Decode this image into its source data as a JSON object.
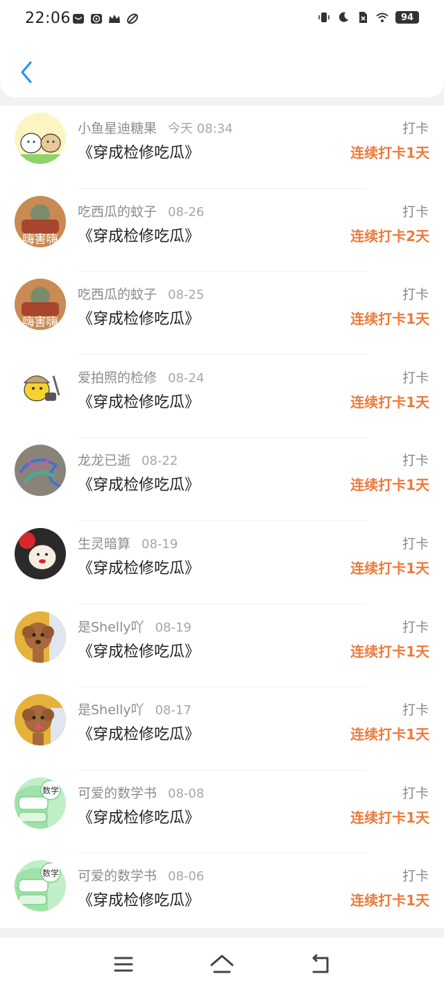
{
  "status_bar": {
    "time": "22:06",
    "battery": "94",
    "left_icons": [
      "mail-icon",
      "play-icon",
      "crown-icon",
      "leaf-icon"
    ],
    "right_icons": [
      "vibrate-icon",
      "moon-icon",
      "sim-off-icon",
      "wifi-icon"
    ]
  },
  "header": {
    "back_icon": "chevron-left-icon",
    "accent_color": "#2196f3"
  },
  "checkins": [
    {
      "username": "小鱼星迪糖果",
      "date": "今天 08:34",
      "title": "《穿成检修吃瓜》",
      "action": "打卡",
      "streak": "连续打卡1天",
      "avatar": "puppy-cartoon"
    },
    {
      "username": "吃西瓜的蚊子",
      "date": "08-26",
      "title": "《穿成检修吃瓜》",
      "action": "打卡",
      "streak": "连续打卡2天",
      "avatar": "cartoon-meme",
      "avatar_text": "嗨害嗨"
    },
    {
      "username": "吃西瓜的蚊子",
      "date": "08-25",
      "title": "《穿成检修吃瓜》",
      "action": "打卡",
      "streak": "连续打卡1天",
      "avatar": "cartoon-meme",
      "avatar_text": "嗨害嗨"
    },
    {
      "username": "爱拍照的检修",
      "date": "08-24",
      "title": "《穿成检修吃瓜》",
      "action": "打卡",
      "streak": "连续打卡1天",
      "avatar": "duck-worker"
    },
    {
      "username": "龙龙已逝",
      "date": "08-22",
      "title": "《穿成检修吃瓜》",
      "action": "打卡",
      "streak": "连续打卡1天",
      "avatar": "dragon-drawing"
    },
    {
      "username": "生灵暗算",
      "date": "08-19",
      "title": "《穿成检修吃瓜》",
      "action": "打卡",
      "streak": "连续打卡1天",
      "avatar": "cartoon-face"
    },
    {
      "username": "是Shelly吖",
      "date": "08-19",
      "title": "《穿成检修吃瓜》",
      "action": "打卡",
      "streak": "连续打卡1天",
      "avatar": "poodle-photo"
    },
    {
      "username": "是Shelly吖",
      "date": "08-17",
      "title": "《穿成检修吃瓜》",
      "action": "打卡",
      "streak": "连续打卡1天",
      "avatar": "poodle-photo"
    },
    {
      "username": "可爱的数学书",
      "date": "08-08",
      "title": "《穿成检修吃瓜》",
      "action": "打卡",
      "streak": "连续打卡1天",
      "avatar": "math-book",
      "avatar_text": "数学"
    },
    {
      "username": "可爱的数学书",
      "date": "08-06",
      "title": "《穿成检修吃瓜》",
      "action": "打卡",
      "streak": "连续打卡1天",
      "avatar": "math-book",
      "avatar_text": "数学"
    }
  ],
  "colors": {
    "streak": "#ee7a3a",
    "username": "#8c8c8c",
    "title": "#222222"
  },
  "nav_bar": {
    "icons": [
      "menu-icon",
      "home-icon",
      "back-nav-icon"
    ]
  }
}
